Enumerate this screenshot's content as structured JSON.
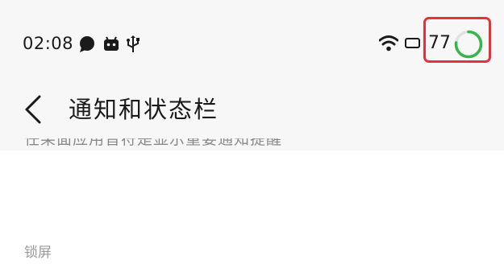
{
  "status_bar": {
    "time": "02:08",
    "notification_icons": [
      "chat-bubble-icon",
      "android-icon",
      "usb-icon"
    ],
    "system_icons": [
      "wifi-icon",
      "battery-icon"
    ],
    "battery_level": "77",
    "battery_fraction": 0.77,
    "colors": {
      "ring": "#35b54a",
      "highlight": "#e5323a"
    }
  },
  "header": {
    "back_icon": "chevron-left-icon",
    "title": "通知和状态栏"
  },
  "content": {
    "clipped_description": "任果面应用音符是显示重要通知提醒",
    "section_label": "锁屏"
  }
}
